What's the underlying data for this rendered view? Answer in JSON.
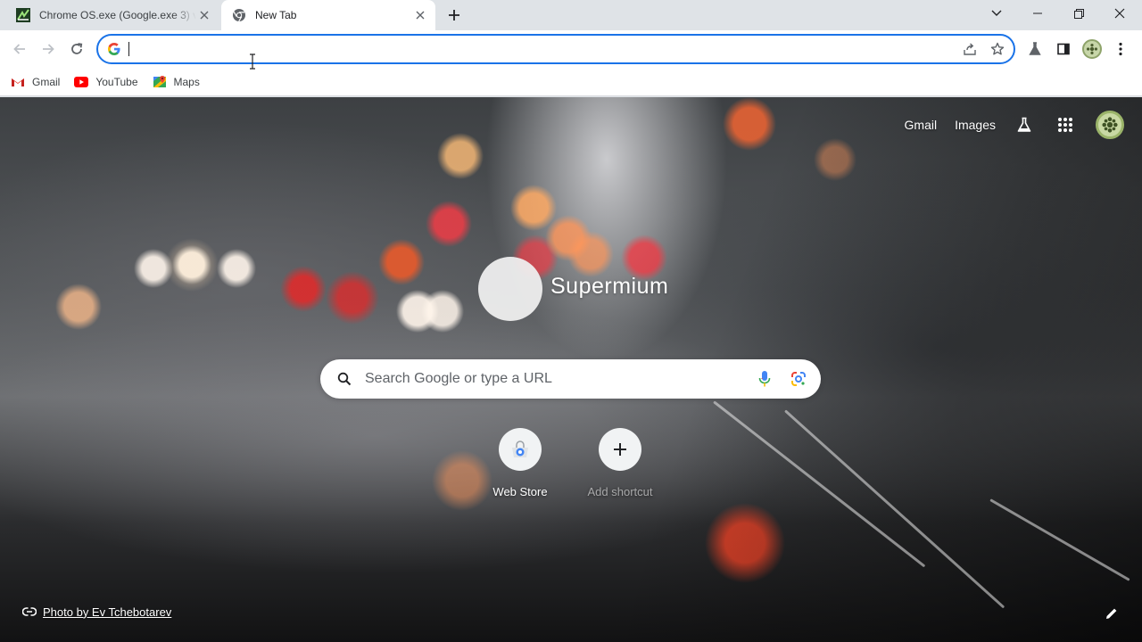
{
  "tabs": [
    {
      "title": "Chrome OS.exe (Google.exe 3) ve",
      "active": false
    },
    {
      "title": "New Tab",
      "active": true
    }
  ],
  "window_controls": [
    "chevron-down-icon",
    "minimize-icon",
    "restore-icon",
    "close-icon"
  ],
  "toolbar": {
    "omnibox_value": "",
    "omnibox_placeholder": ""
  },
  "bookmarks": [
    {
      "label": "Gmail",
      "icon": "gmail-icon"
    },
    {
      "label": "YouTube",
      "icon": "youtube-icon"
    },
    {
      "label": "Maps",
      "icon": "maps-icon"
    }
  ],
  "ntp": {
    "top_links": {
      "gmail": "Gmail",
      "images": "Images"
    },
    "logo_text": "Supermium",
    "search_placeholder": "Search Google or type a URL",
    "shortcuts": [
      {
        "label": "Web Store"
      },
      {
        "label": "Add shortcut"
      }
    ],
    "attribution": "Photo by Ev Tchebotarev"
  },
  "colors": {
    "accent": "#1a73e8",
    "tabstrip_bg": "#dfe3e7",
    "toolbar_bg": "#ffffff"
  }
}
